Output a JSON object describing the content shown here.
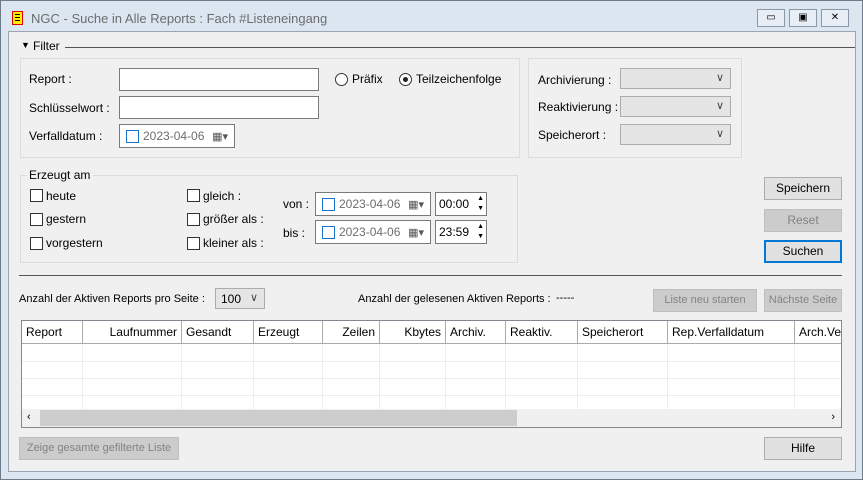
{
  "window": {
    "title": "NGC - Suche in Alle Reports : Fach #Listeneingang",
    "min": "▭",
    "max": "▣",
    "close": "✕"
  },
  "filter": {
    "label": "Filter",
    "report_label": "Report :",
    "report_value": "",
    "keyword_label": "Schlüsselwort :",
    "keyword_value": "",
    "expiry_label": "Verfalldatum :",
    "expiry_date": "2023-04-06",
    "prefix_label": "Präfix",
    "substring_label": "Teilzeichenfolge",
    "archiving_label": "Archivierung :",
    "reactivation_label": "Reaktivierung :",
    "storage_label": "Speicherort :"
  },
  "created": {
    "label": "Erzeugt am",
    "today": "heute",
    "yesterday": "gestern",
    "day_before": "vorgestern",
    "equal": "gleich :",
    "greater": "größer als :",
    "less": "kleiner als :",
    "from_label": "von :",
    "from_date": "2023-04-06",
    "from_time": "00:00",
    "to_label": "bis :",
    "to_date": "2023-04-06",
    "to_time": "23:59"
  },
  "buttons": {
    "save": "Speichern",
    "reset": "Reset",
    "search": "Suchen",
    "restart": "Liste neu starten",
    "next": "Nächste Seite",
    "show_all": "Zeige gesamte gefilterte Liste",
    "help": "Hilfe"
  },
  "paging": {
    "per_page_label": "Anzahl der Aktiven Reports pro Seite :",
    "per_page": "100",
    "read_label": "Anzahl der gelesenen Aktiven Reports :",
    "read_value": "-----"
  },
  "table": {
    "columns": [
      "Report",
      "Laufnummer",
      "Gesandt",
      "Erzeugt",
      "Zeilen",
      "Kbytes",
      "Archiv.",
      "Reaktiv.",
      "Speicherort",
      "Rep.Verfalldatum",
      "Arch.Ve"
    ]
  }
}
